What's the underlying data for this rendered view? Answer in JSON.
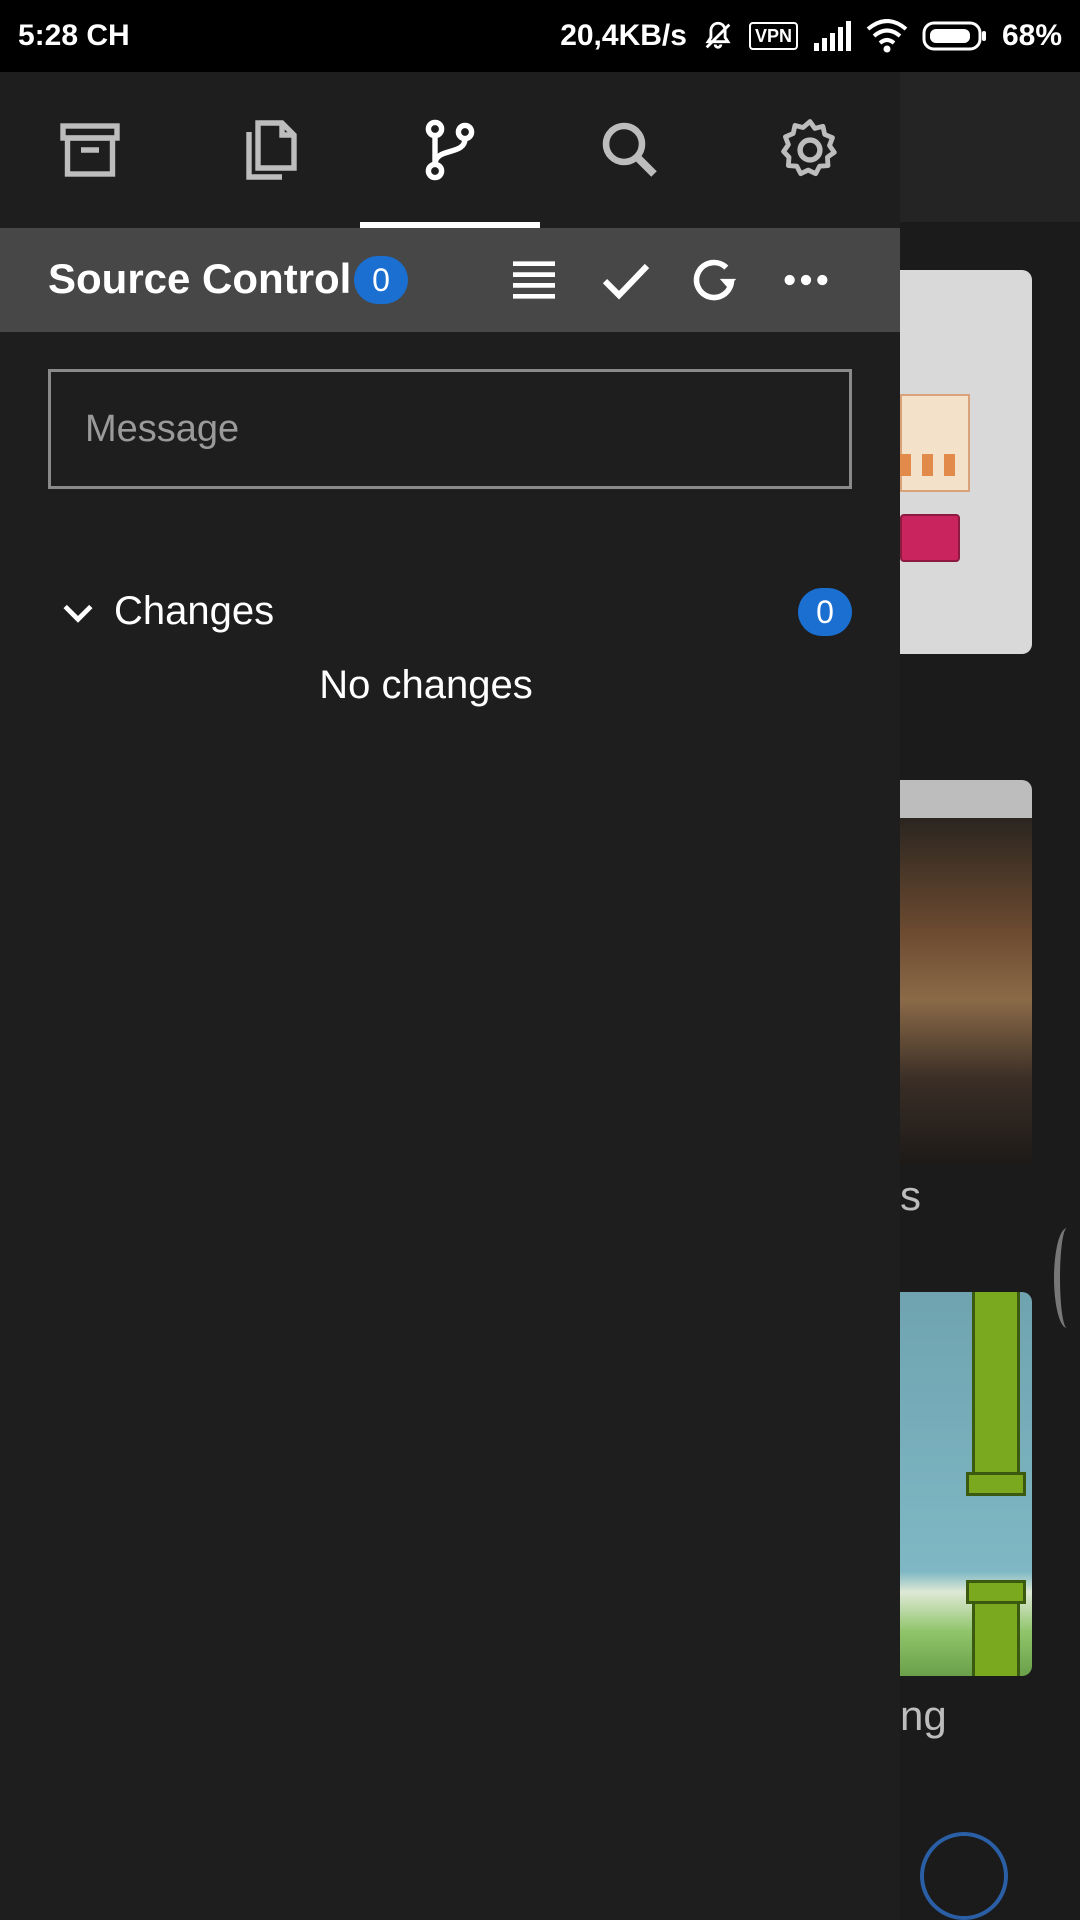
{
  "status_bar": {
    "time": "5:28 CH",
    "network_speed": "20,4KB/s",
    "vpn_label": "VPN",
    "battery_percent": "68%",
    "icons": [
      "mute-bell-icon",
      "signal-icon",
      "wifi-icon",
      "battery-icon"
    ]
  },
  "toolbar": {
    "items": [
      {
        "icon": "archive-icon"
      },
      {
        "icon": "files-icon"
      },
      {
        "icon": "source-control-icon",
        "active": true
      },
      {
        "icon": "search-icon"
      },
      {
        "icon": "settings-icon"
      }
    ]
  },
  "source_control": {
    "title": "Source Control",
    "count": "0",
    "actions": [
      "view-as-list-icon",
      "commit-check-icon",
      "refresh-icon",
      "more-icon"
    ]
  },
  "message_input": {
    "placeholder": "Message",
    "value": ""
  },
  "changes": {
    "label": "Changes",
    "count": "0",
    "empty_text": "No changes"
  },
  "background_app": {
    "text_1": "s",
    "text_2": "ng"
  },
  "colors": {
    "accent_badge": "#1a6fd0",
    "drawer_bg": "#1e1e1e",
    "header_bg": "#474747"
  }
}
